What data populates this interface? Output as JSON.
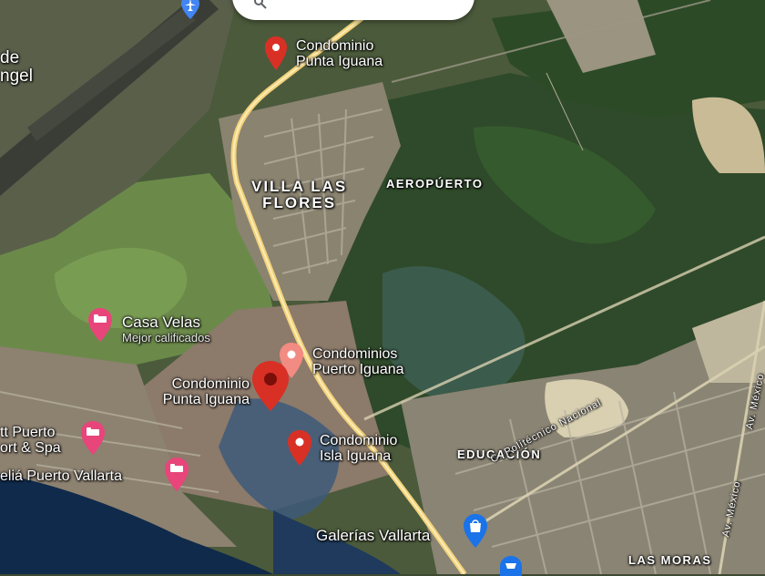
{
  "search": {
    "icon": "search-icon"
  },
  "places": {
    "condominio_punta_iguana_north": {
      "name_line1": "Condominio",
      "name_line2": "Punta Iguana",
      "icon": "red-pin-icon"
    },
    "casa_velas": {
      "name": "Casa Velas",
      "subtitle": "Mejor calificados",
      "icon": "hotel-pin-icon"
    },
    "condominios_puerto_iguana": {
      "name_line1": "Condominios",
      "name_line2": "Puerto Iguana",
      "icon": "pink-pin-icon"
    },
    "condominio_punta_iguana_selected": {
      "name_line1": "Condominio",
      "name_line2": "Punta Iguana",
      "icon": "selected-red-pin-icon"
    },
    "condominio_isla_iguana": {
      "name_line1": "Condominio",
      "name_line2": "Isla Iguana",
      "icon": "red-pin-icon"
    },
    "hyatt": {
      "name_line1": "tt Puerto",
      "name_line2": "ort & Spa",
      "icon": "hotel-pin-icon"
    },
    "melia": {
      "name": "eliá Puerto Vallarta",
      "icon": "hotel-pin-icon"
    },
    "galerias": {
      "name": "Galerías Vallarta",
      "icon": "shopping-pin-icon"
    },
    "angel_partial": {
      "line1": "de",
      "line2": "ngel"
    }
  },
  "areas": {
    "villa_las_flores": {
      "line1": "VILLA LAS",
      "line2": "FLORES"
    },
    "aeropuerto": "AEROPÚERTO",
    "educacion": "EDUCACIÓN",
    "las_moras": "LAS MORAS"
  },
  "streets": {
    "politecnico": "C. Politécnico Nacional",
    "av_mexico_1": "Av. México",
    "av_mexico_2": "Av. México"
  },
  "colors": {
    "pin_red": "#d93025",
    "pin_pink": "#f28b82",
    "hotel_pink": "#e8457a",
    "shopping_blue": "#1a73e8",
    "airport_blue": "#4285f4",
    "highway_yellow": "#f2d27a"
  }
}
